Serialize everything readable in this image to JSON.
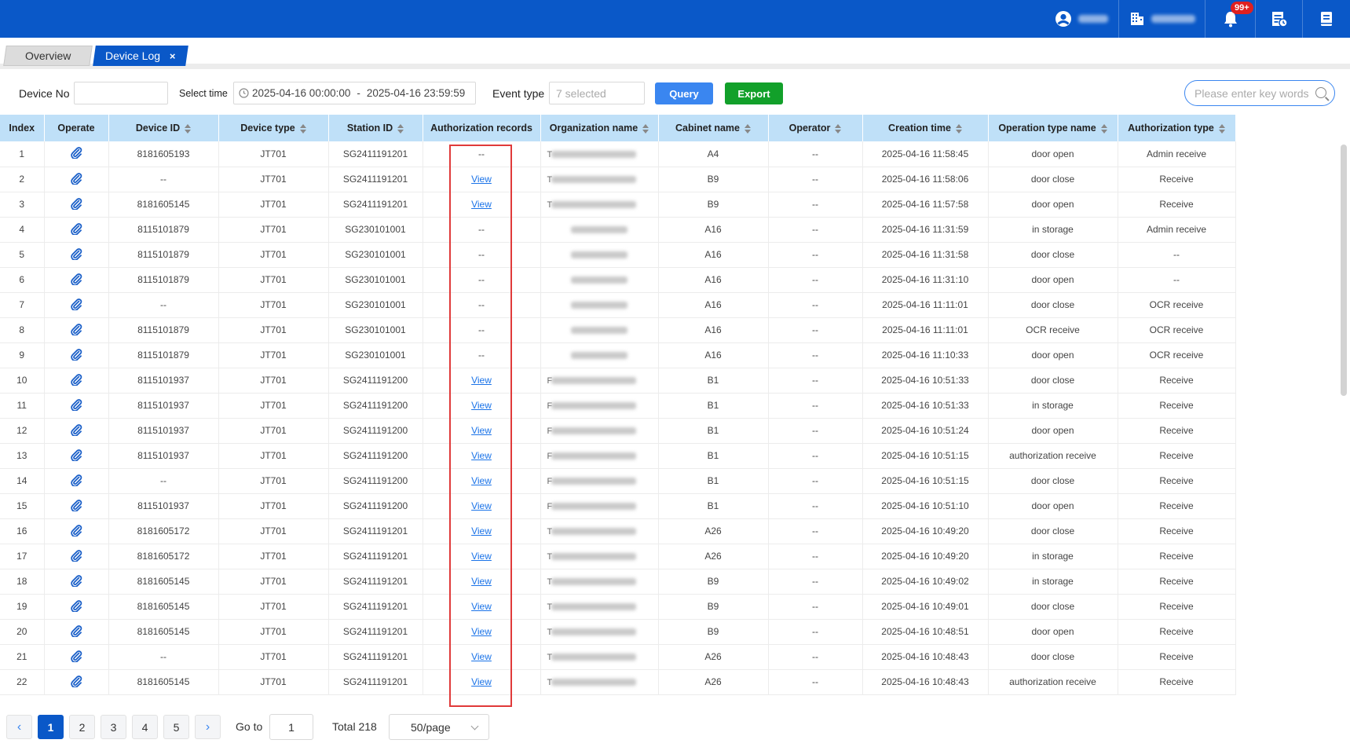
{
  "header": {
    "user_icon": "user-icon",
    "org_icon": "building-icon",
    "bell_icon": "bell-icon",
    "notification_badge": "99+",
    "report_icon": "report-icon",
    "book_icon": "book-icon",
    "background": "#0a58c8"
  },
  "tabs": [
    {
      "label": "Overview",
      "active": false
    },
    {
      "label": "Device Log",
      "active": true,
      "close": "×"
    }
  ],
  "filters": {
    "device_no_label": "Device No",
    "device_no_value": "",
    "select_time_label": "Select time",
    "time_start": "2025-04-16 00:00:00",
    "time_separator": "-",
    "time_end": "2025-04-16 23:59:59",
    "event_type_label": "Event type",
    "event_type_placeholder": "7 selected",
    "query_label": "Query",
    "export_label": "Export",
    "search_placeholder": "Please enter key words"
  },
  "table": {
    "columns": [
      "Index",
      "Operate",
      "Device ID",
      "Device type",
      "Station ID",
      "Authorization records",
      "Organization name",
      "Cabinet name",
      "Operator",
      "Creation time",
      "Operation type name",
      "Authorization type"
    ],
    "sortable": [
      false,
      false,
      true,
      true,
      true,
      false,
      true,
      true,
      true,
      true,
      true,
      true
    ],
    "rows": [
      {
        "index": "1",
        "device_id": "8181605193",
        "device_type": "JT701",
        "station_id": "SG2411191201",
        "auth": "--",
        "org_lead": "T",
        "cabinet": "A4",
        "operator": "--",
        "time": "2025-04-16 11:58:45",
        "op_type": "door open",
        "auth_type": "Admin receive"
      },
      {
        "index": "2",
        "device_id": "--",
        "device_type": "JT701",
        "station_id": "SG2411191201",
        "auth": "View",
        "org_lead": "T",
        "cabinet": "B9",
        "operator": "--",
        "time": "2025-04-16 11:58:06",
        "op_type": "door close",
        "auth_type": "Receive"
      },
      {
        "index": "3",
        "device_id": "8181605145",
        "device_type": "JT701",
        "station_id": "SG2411191201",
        "auth": "View",
        "org_lead": "T",
        "cabinet": "B9",
        "operator": "--",
        "time": "2025-04-16 11:57:58",
        "op_type": "door open",
        "auth_type": "Receive"
      },
      {
        "index": "4",
        "device_id": "8115101879",
        "device_type": "JT701",
        "station_id": "SG230101001",
        "auth": "--",
        "org_lead": "",
        "cabinet": "A16",
        "operator": "--",
        "time": "2025-04-16 11:31:59",
        "op_type": "in storage",
        "auth_type": "Admin receive"
      },
      {
        "index": "5",
        "device_id": "8115101879",
        "device_type": "JT701",
        "station_id": "SG230101001",
        "auth": "--",
        "org_lead": "",
        "cabinet": "A16",
        "operator": "--",
        "time": "2025-04-16 11:31:58",
        "op_type": "door close",
        "auth_type": "--"
      },
      {
        "index": "6",
        "device_id": "8115101879",
        "device_type": "JT701",
        "station_id": "SG230101001",
        "auth": "--",
        "org_lead": "",
        "cabinet": "A16",
        "operator": "--",
        "time": "2025-04-16 11:31:10",
        "op_type": "door open",
        "auth_type": "--"
      },
      {
        "index": "7",
        "device_id": "--",
        "device_type": "JT701",
        "station_id": "SG230101001",
        "auth": "--",
        "org_lead": "",
        "cabinet": "A16",
        "operator": "--",
        "time": "2025-04-16 11:11:01",
        "op_type": "door close",
        "auth_type": "OCR receive"
      },
      {
        "index": "8",
        "device_id": "8115101879",
        "device_type": "JT701",
        "station_id": "SG230101001",
        "auth": "--",
        "org_lead": "",
        "cabinet": "A16",
        "operator": "--",
        "time": "2025-04-16 11:11:01",
        "op_type": "OCR receive",
        "auth_type": "OCR receive"
      },
      {
        "index": "9",
        "device_id": "8115101879",
        "device_type": "JT701",
        "station_id": "SG230101001",
        "auth": "--",
        "org_lead": "",
        "cabinet": "A16",
        "operator": "--",
        "time": "2025-04-16 11:10:33",
        "op_type": "door open",
        "auth_type": "OCR receive"
      },
      {
        "index": "10",
        "device_id": "8115101937",
        "device_type": "JT701",
        "station_id": "SG2411191200",
        "auth": "View",
        "org_lead": "F",
        "cabinet": "B1",
        "operator": "--",
        "time": "2025-04-16 10:51:33",
        "op_type": "door close",
        "auth_type": "Receive"
      },
      {
        "index": "11",
        "device_id": "8115101937",
        "device_type": "JT701",
        "station_id": "SG2411191200",
        "auth": "View",
        "org_lead": "F",
        "cabinet": "B1",
        "operator": "--",
        "time": "2025-04-16 10:51:33",
        "op_type": "in storage",
        "auth_type": "Receive"
      },
      {
        "index": "12",
        "device_id": "8115101937",
        "device_type": "JT701",
        "station_id": "SG2411191200",
        "auth": "View",
        "org_lead": "F",
        "cabinet": "B1",
        "operator": "--",
        "time": "2025-04-16 10:51:24",
        "op_type": "door open",
        "auth_type": "Receive"
      },
      {
        "index": "13",
        "device_id": "8115101937",
        "device_type": "JT701",
        "station_id": "SG2411191200",
        "auth": "View",
        "org_lead": "F",
        "cabinet": "B1",
        "operator": "--",
        "time": "2025-04-16 10:51:15",
        "op_type": "authorization receive",
        "auth_type": "Receive"
      },
      {
        "index": "14",
        "device_id": "--",
        "device_type": "JT701",
        "station_id": "SG2411191200",
        "auth": "View",
        "org_lead": "F",
        "cabinet": "B1",
        "operator": "--",
        "time": "2025-04-16 10:51:15",
        "op_type": "door close",
        "auth_type": "Receive"
      },
      {
        "index": "15",
        "device_id": "8115101937",
        "device_type": "JT701",
        "station_id": "SG2411191200",
        "auth": "View",
        "org_lead": "F",
        "cabinet": "B1",
        "operator": "--",
        "time": "2025-04-16 10:51:10",
        "op_type": "door open",
        "auth_type": "Receive"
      },
      {
        "index": "16",
        "device_id": "8181605172",
        "device_type": "JT701",
        "station_id": "SG2411191201",
        "auth": "View",
        "org_lead": "T",
        "cabinet": "A26",
        "operator": "--",
        "time": "2025-04-16 10:49:20",
        "op_type": "door close",
        "auth_type": "Receive"
      },
      {
        "index": "17",
        "device_id": "8181605172",
        "device_type": "JT701",
        "station_id": "SG2411191201",
        "auth": "View",
        "org_lead": "T",
        "cabinet": "A26",
        "operator": "--",
        "time": "2025-04-16 10:49:20",
        "op_type": "in storage",
        "auth_type": "Receive"
      },
      {
        "index": "18",
        "device_id": "8181605145",
        "device_type": "JT701",
        "station_id": "SG2411191201",
        "auth": "View",
        "org_lead": "T",
        "cabinet": "B9",
        "operator": "--",
        "time": "2025-04-16 10:49:02",
        "op_type": "in storage",
        "auth_type": "Receive"
      },
      {
        "index": "19",
        "device_id": "8181605145",
        "device_type": "JT701",
        "station_id": "SG2411191201",
        "auth": "View",
        "org_lead": "T",
        "cabinet": "B9",
        "operator": "--",
        "time": "2025-04-16 10:49:01",
        "op_type": "door close",
        "auth_type": "Receive"
      },
      {
        "index": "20",
        "device_id": "8181605145",
        "device_type": "JT701",
        "station_id": "SG2411191201",
        "auth": "View",
        "org_lead": "T",
        "cabinet": "B9",
        "operator": "--",
        "time": "2025-04-16 10:48:51",
        "op_type": "door open",
        "auth_type": "Receive"
      },
      {
        "index": "21",
        "device_id": "--",
        "device_type": "JT701",
        "station_id": "SG2411191201",
        "auth": "View",
        "org_lead": "T",
        "cabinet": "A26",
        "operator": "--",
        "time": "2025-04-16 10:48:43",
        "op_type": "door close",
        "auth_type": "Receive"
      },
      {
        "index": "22",
        "device_id": "8181605145",
        "device_type": "JT701",
        "station_id": "SG2411191201",
        "auth": "View",
        "org_lead": "T",
        "cabinet": "A26",
        "operator": "--",
        "time": "2025-04-16 10:48:43",
        "op_type": "authorization receive",
        "auth_type": "Receive"
      }
    ],
    "highlight_color": "#e03a3a",
    "header_color": "#bfe0f8",
    "link_color": "#1a73e8"
  },
  "pagination": {
    "prev": "‹",
    "pages": [
      "1",
      "2",
      "3",
      "4",
      "5"
    ],
    "active_page": "1",
    "next": "›",
    "goto_label": "Go to",
    "goto_value": "1",
    "total": "Total 218",
    "page_size": "50/page"
  }
}
